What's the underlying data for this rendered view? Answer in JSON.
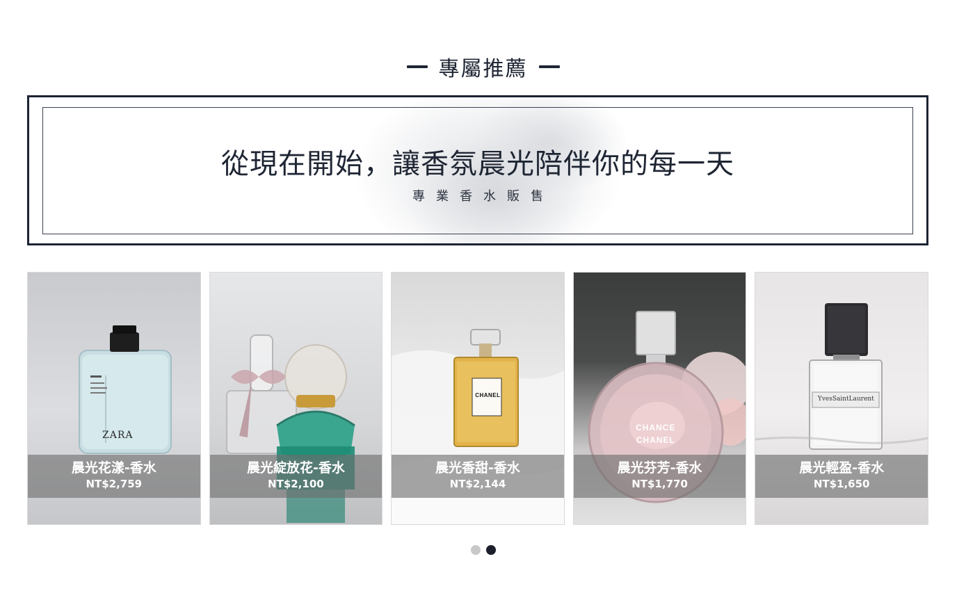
{
  "section": {
    "title": "專屬推薦"
  },
  "banner": {
    "headline": "從現在開始，讓香氛晨光陪伴你的每一天",
    "subtitle": "專業香水販售"
  },
  "products": [
    {
      "name": "晨光花漾-香水",
      "price": "NT$2,759",
      "bottle_label": "ZARA"
    },
    {
      "name": "晨光綻放花-香水",
      "price": "NT$2,100",
      "bottle_label": ""
    },
    {
      "name": "晨光香甜-香水",
      "price": "NT$2,144",
      "bottle_label": "CHANEL"
    },
    {
      "name": "晨光芬芳-香水",
      "price": "NT$1,770",
      "bottle_label": "CHANCE CHANEL"
    },
    {
      "name": "晨光輕盈-香水",
      "price": "NT$1,650",
      "bottle_label": "YvesSaintLaurent"
    }
  ],
  "carousel": {
    "page_count": 2,
    "active_index": 1
  },
  "colors": {
    "navy": "#1e2533",
    "caption_overlay": "#6e6e6e",
    "dot_inactive": "#c8c8c8",
    "dot_active": "#1a1f2b"
  }
}
